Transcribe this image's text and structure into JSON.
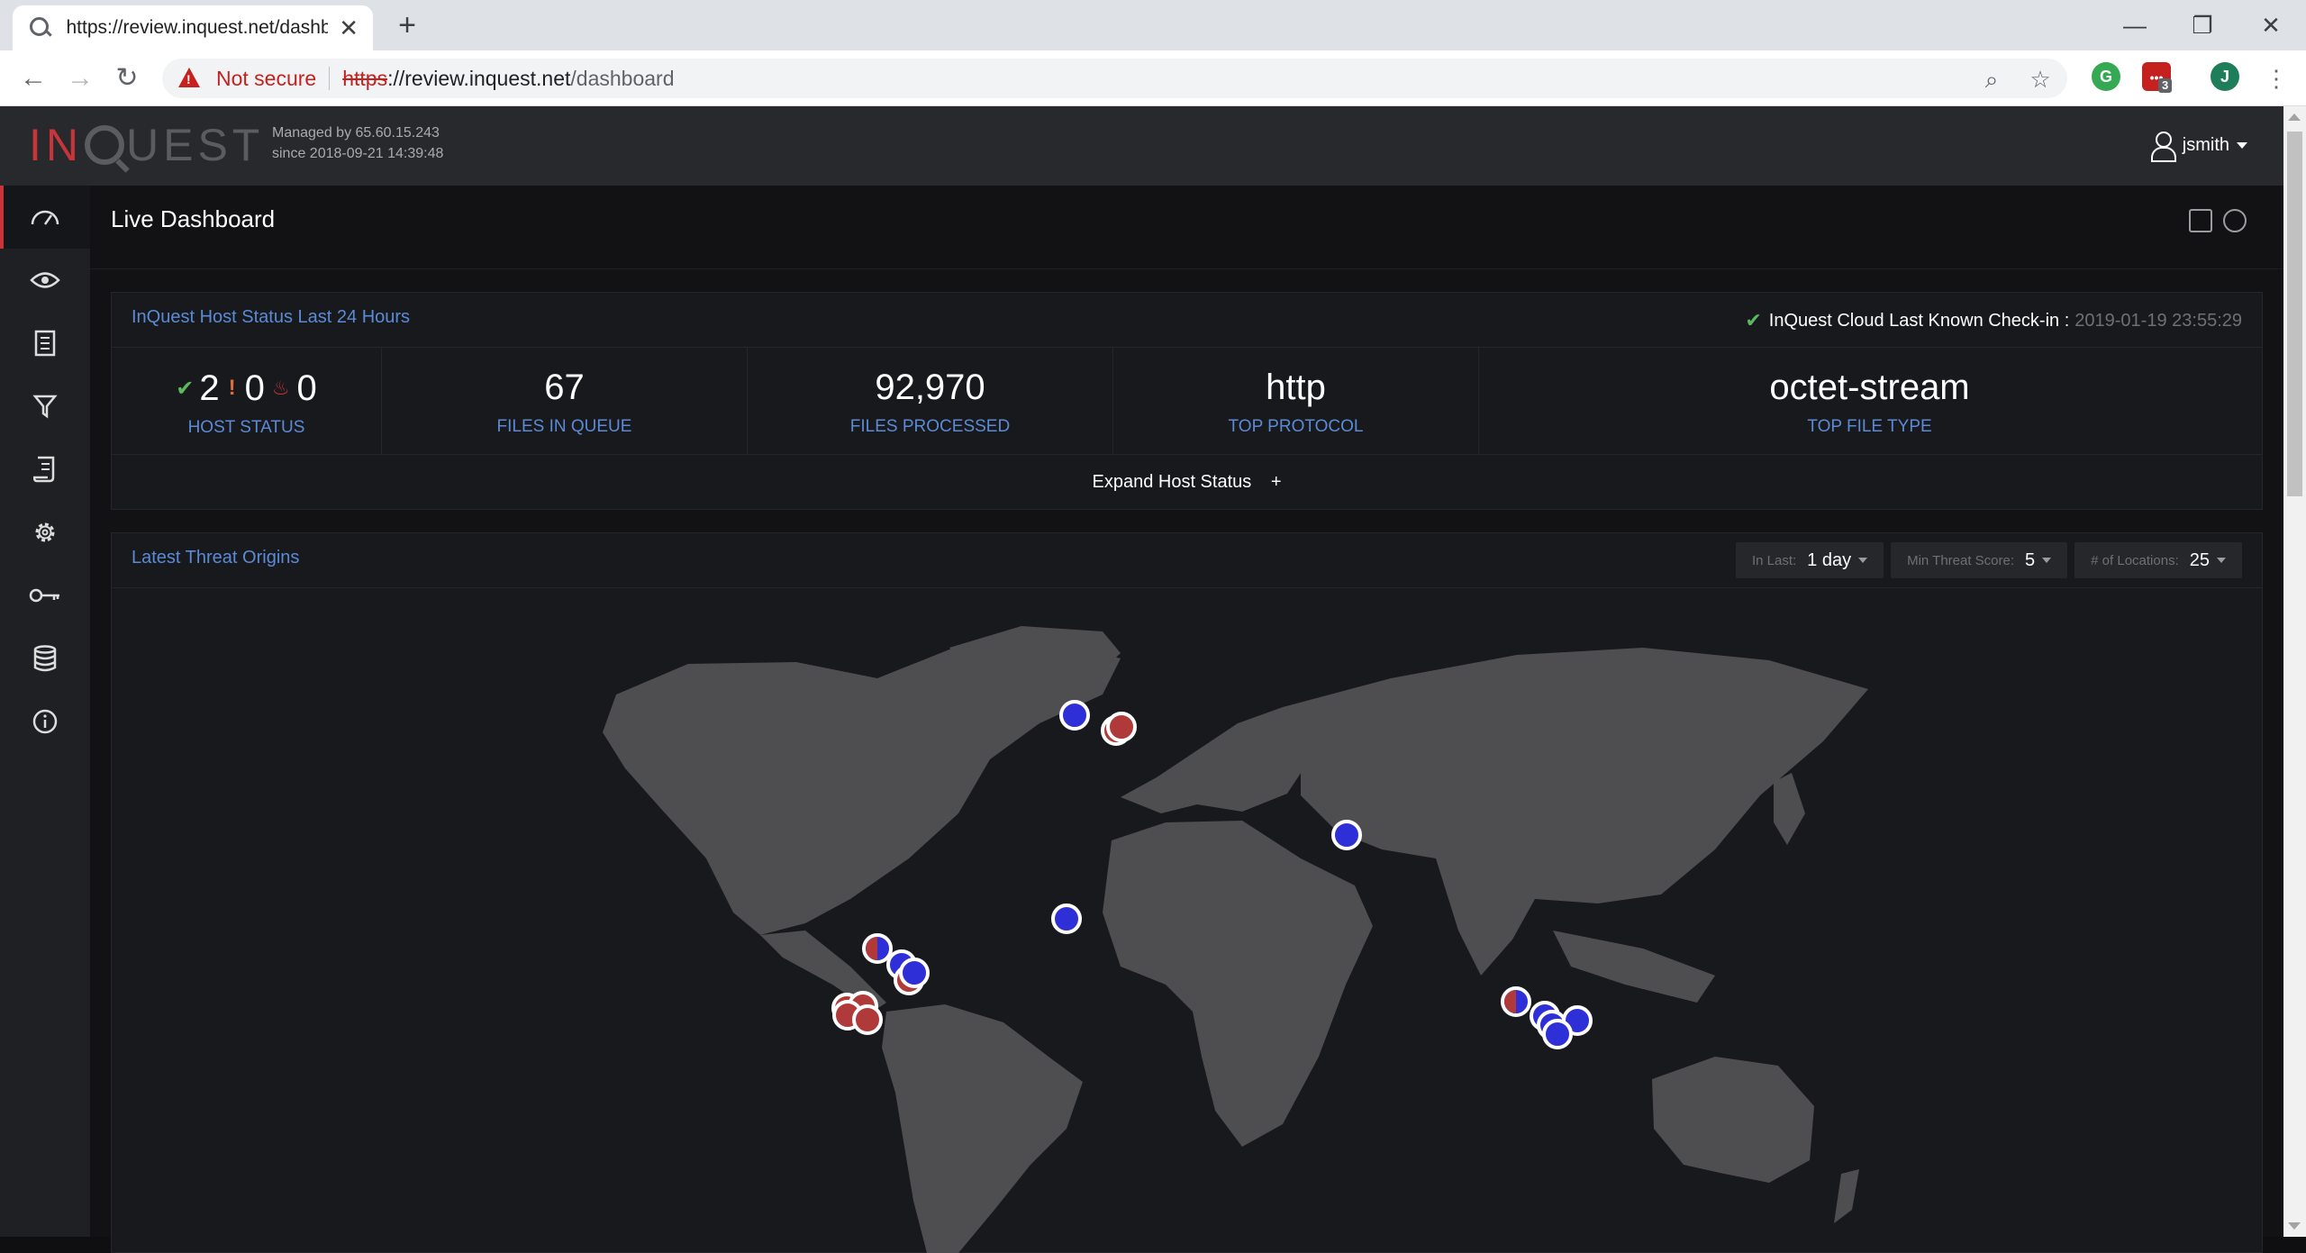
{
  "browser": {
    "tab_title": "https://review.inquest.net/dashboard",
    "not_secure": "Not secure",
    "url_scheme": "https",
    "url_host": "://review.inquest.net",
    "url_path": "/dashboard",
    "extension_badge": "3",
    "profile_initial": "J"
  },
  "app": {
    "logo_left": "IN",
    "logo_right": "UEST",
    "managed_line1": "Managed by 65.60.15.243",
    "managed_line2": "since 2018-09-21 14:39:48",
    "username": "jsmith"
  },
  "sidebar": {
    "items": [
      {
        "icon": "dashboard-gauge-icon"
      },
      {
        "icon": "eye-icon"
      },
      {
        "icon": "document-list-icon"
      },
      {
        "icon": "filter-icon"
      },
      {
        "icon": "report-icon"
      },
      {
        "icon": "gear-icon"
      },
      {
        "icon": "key-icon"
      },
      {
        "icon": "database-icon"
      },
      {
        "icon": "info-icon"
      }
    ]
  },
  "page": {
    "title": "Live Dashboard"
  },
  "host_status_panel": {
    "title": "InQuest Host Status Last 24 Hours",
    "checkin_label": "InQuest Cloud Last Known Check-in :",
    "checkin_time": "2019-01-19 23:55:29",
    "host_ok": "2",
    "host_warn": "0",
    "host_critical": "0",
    "host_status_label": "HOST STATUS",
    "files_in_queue": "67",
    "files_in_queue_label": "FILES IN QUEUE",
    "files_processed": "92,970",
    "files_processed_label": "FILES PROCESSED",
    "top_protocol": "http",
    "top_protocol_label": "TOP PROTOCOL",
    "top_file_type": "octet-stream",
    "top_file_type_label": "TOP FILE TYPE",
    "expand_label": "Expand Host Status",
    "expand_icon": "+"
  },
  "threat_panel": {
    "title": "Latest Threat Origins",
    "filters": {
      "in_last_label": "In Last:",
      "in_last_value": "1 day",
      "min_score_label": "Min Threat Score:",
      "min_score_value": "5",
      "locations_label": "# of Locations:",
      "locations_value": "25"
    },
    "colors": {
      "benign_pin": "#2f2fd8",
      "malicious_pin": "#b03a3a",
      "land": "#4e4e50"
    }
  }
}
